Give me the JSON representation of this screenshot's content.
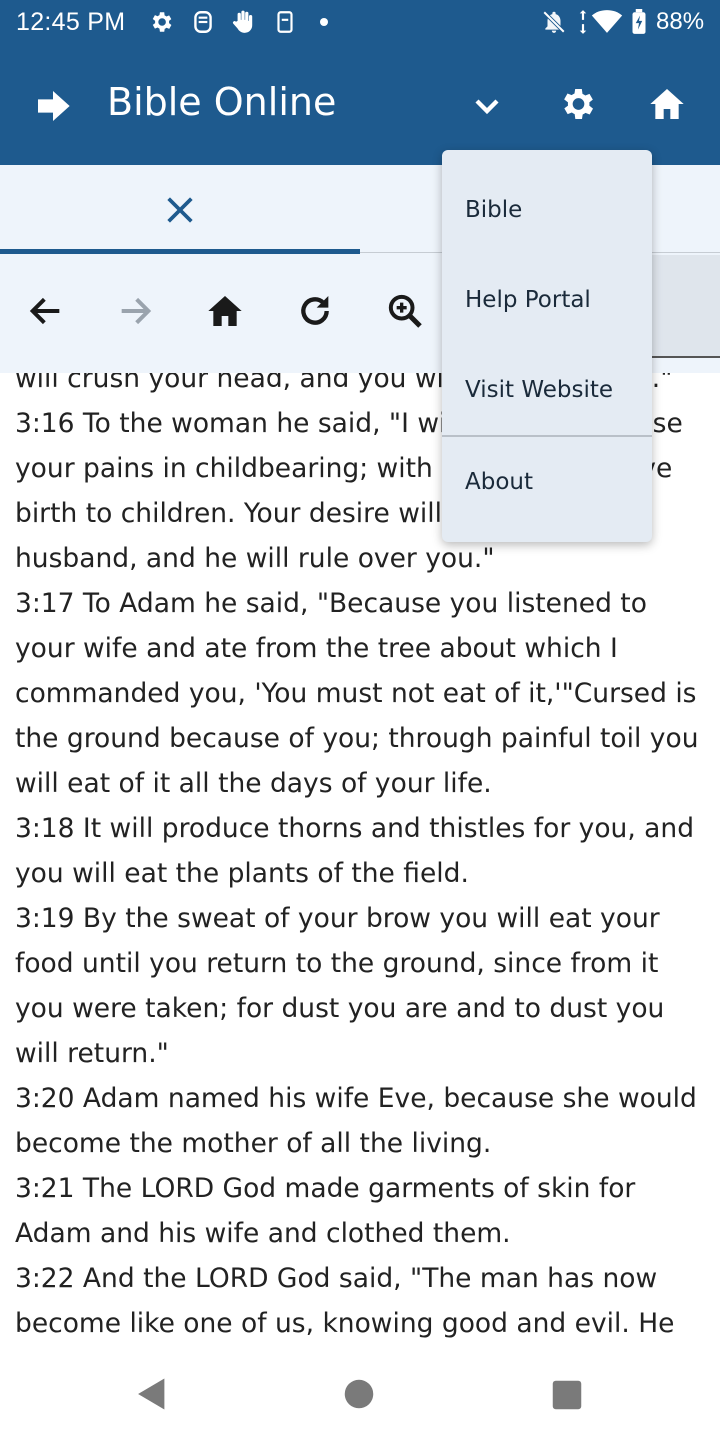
{
  "status_bar": {
    "time": "12:45 PM",
    "battery": "88%",
    "icons": [
      "settings-icon",
      "sim-icon",
      "hand-icon",
      "phone-icon",
      "dot",
      "mute-icon",
      "data-arrows-icon",
      "wifi-icon",
      "battery-icon"
    ]
  },
  "app_bar": {
    "title": "Bible Online",
    "icons": [
      "forward-arrow-icon",
      "chevron-down-icon",
      "gear-icon",
      "home-icon"
    ],
    "color": "#1e5a8e"
  },
  "tabs": {
    "active_icon": "close-icon"
  },
  "toolbar": {
    "icons": [
      "back-arrow-icon",
      "forward-arrow-icon",
      "home-icon",
      "refresh-icon",
      "zoom-in-icon"
    ]
  },
  "content": {
    "verses": [
      "will crush your head, and you will strike his heel.\"",
      "3:16 To the woman he said, \"I will greatly increase your pains in childbearing; with pain you will give birth to children. Your desire will be for your husband, and he will rule over you.\"",
      "3:17 To Adam he said, \"Because you listened to your wife and ate from the tree about which I commanded you, 'You must not eat of it,'\"Cursed is the ground because of you; through painful toil you will eat of it all the days of your life.",
      "3:18 It will produce thorns and thistles for you, and you will eat the plants of the field.",
      "3:19 By the sweat of your brow you will eat your food until you return to the ground, since from it you were taken; for dust you are and to dust you will return.\"",
      "3:20 Adam named his wife Eve, because she would become the mother of all the living.",
      "3:21 The LORD God made garments of skin for Adam and his wife and clothed them.",
      "3:22 And the LORD God said, \"The man has now become like one of us, knowing good and evil. He"
    ]
  },
  "menu": {
    "items": [
      "Bible",
      "Help Portal",
      "Visit Website",
      "About"
    ]
  },
  "nav_bar": {
    "icons": [
      "back-triangle-icon",
      "home-circle-icon",
      "recents-square-icon"
    ]
  }
}
